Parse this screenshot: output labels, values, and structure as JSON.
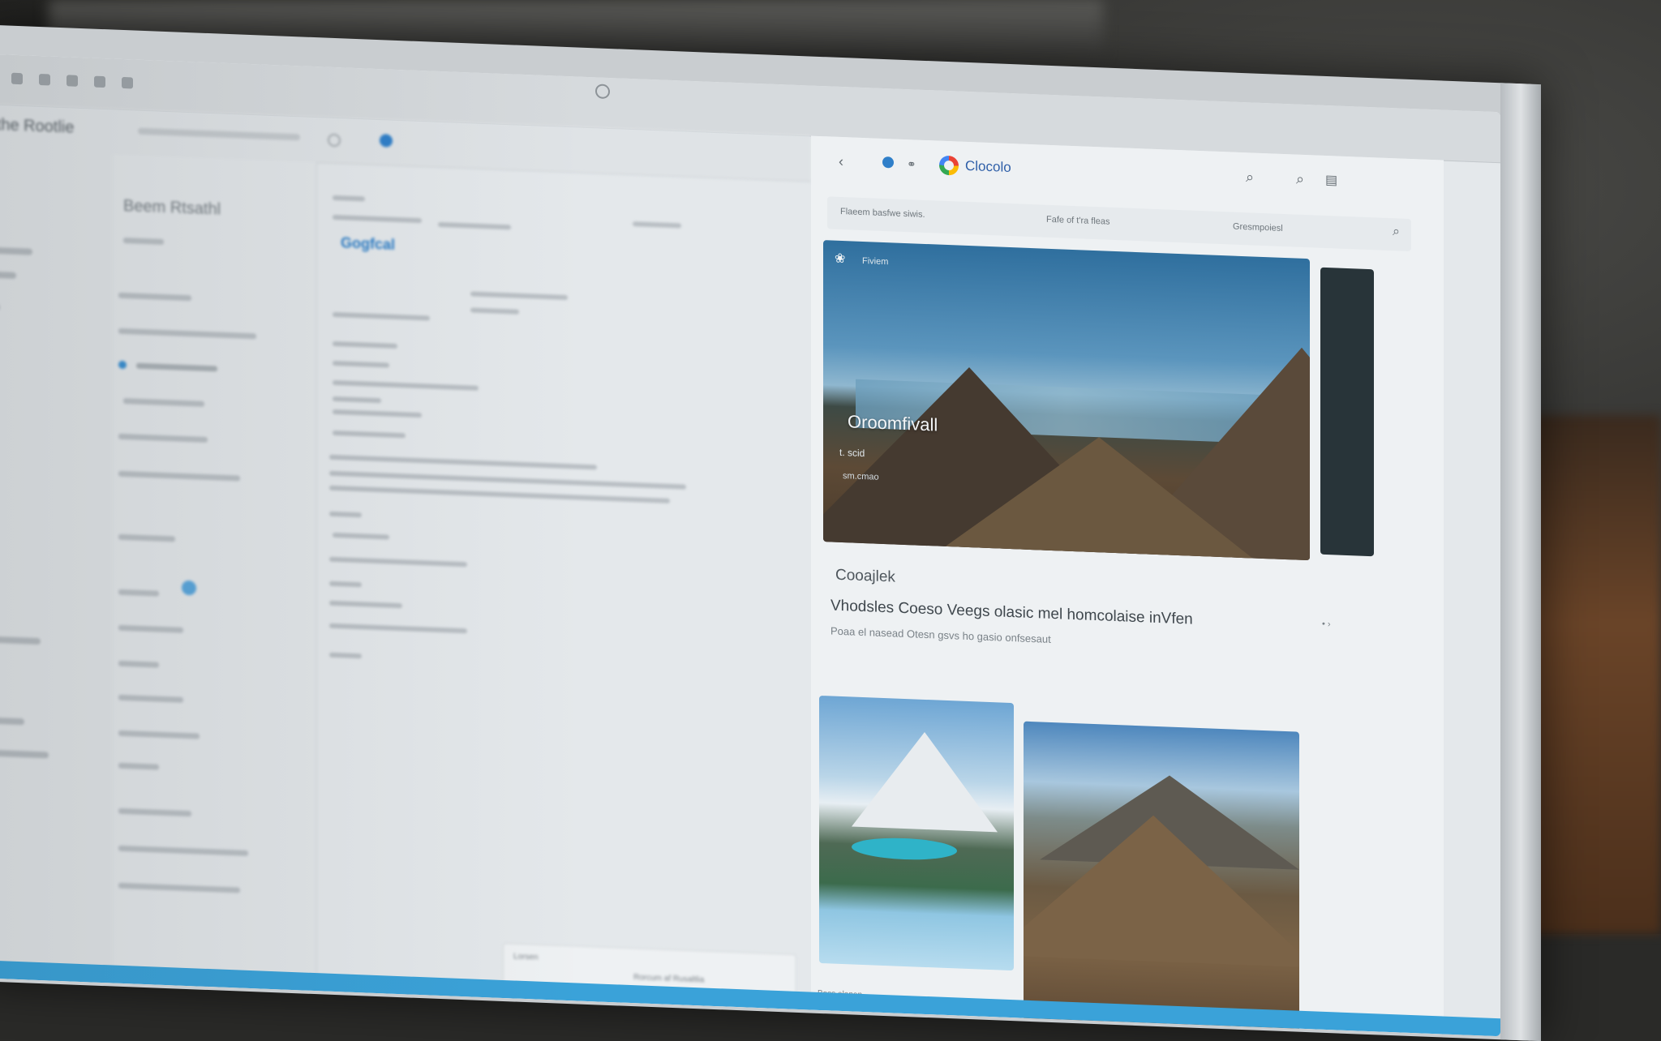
{
  "left_app": {
    "title": "e-the Rootlie",
    "sidebar_heading": "Beem Rtsathl",
    "brand": "Gogfcal"
  },
  "browser": {
    "brand": "Clocolo",
    "search_tabs": [
      "Flaeem basfwe siwis.",
      "Fafe of t'ra fleas",
      "Gresmpoiesl"
    ],
    "hero": {
      "logo_text": "Fiviem",
      "title": "Oroomfivall",
      "subtitle": "t. scid",
      "subtitle2": "sm.cmao"
    },
    "article": {
      "source": "Cooajlek",
      "title": "Vhodsles Coeso Veegs olasic mel homcolaise inVfen",
      "snippet": "Poaa el nasead Otesn gsvs ho gasio onfsesaut",
      "pager": "• ›"
    },
    "bottom_label": "Boss alanen"
  },
  "bottom_panel": {
    "label1": "Lorsen",
    "label2": "Rorcum af Rusaltlia"
  },
  "colors": {
    "accent_blue": "#2f7fc9",
    "brand_blue": "#2a7cc6",
    "taskbar": "#3aa2d9"
  }
}
